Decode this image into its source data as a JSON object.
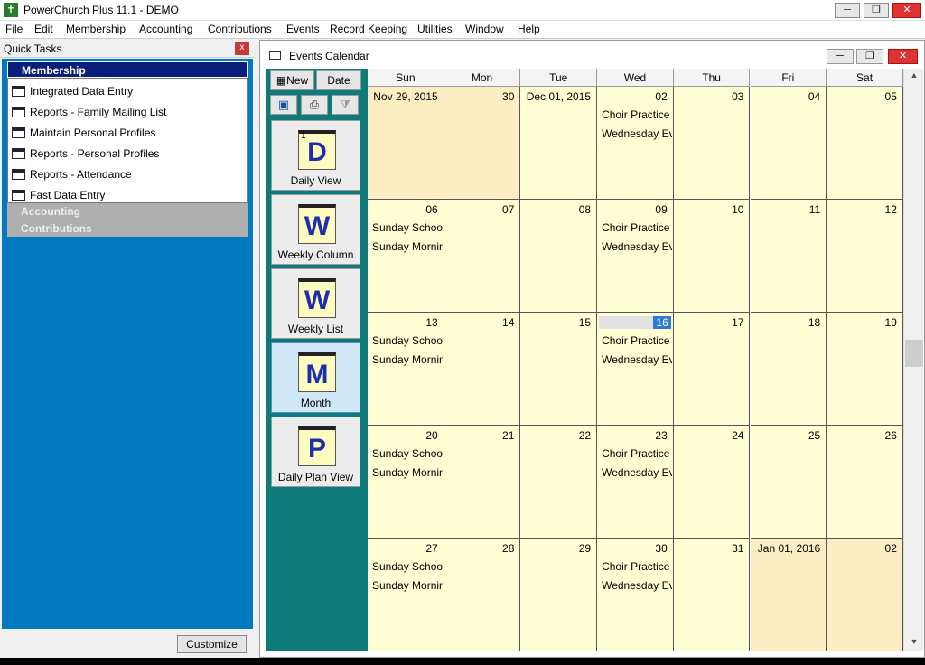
{
  "app": {
    "title": "PowerChurch Plus 11.1 - DEMO"
  },
  "menu": [
    "File",
    "Edit",
    "Membership",
    "Accounting",
    "Contributions",
    "Events",
    "Record Keeping",
    "Utilities",
    "Window",
    "Help"
  ],
  "quick_tasks": {
    "title": "Quick Tasks",
    "active_group": "Membership",
    "items": [
      "Integrated Data Entry",
      "Reports - Family Mailing List",
      "Maintain Personal Profiles",
      "Reports - Personal Profiles",
      "Reports - Attendance",
      "Fast Data Entry"
    ],
    "groups_collapsed": [
      "Accounting",
      "Contributions"
    ],
    "customize_label": "Customize"
  },
  "events_calendar": {
    "title": "Events Calendar",
    "toolbar": {
      "new_label": "New",
      "date_label": "Date"
    },
    "views": [
      {
        "label": "Daily View",
        "letter": "D",
        "corner": "1"
      },
      {
        "label": "Weekly Column",
        "letter": "W",
        "corner": ""
      },
      {
        "label": "Weekly List",
        "letter": "W",
        "corner": ""
      },
      {
        "label": "Month",
        "letter": "M",
        "corner": ""
      },
      {
        "label": "Daily Plan View",
        "letter": "P",
        "corner": ""
      }
    ],
    "selected_view": "Month",
    "weekdays": [
      "Sun",
      "Mon",
      "Tue",
      "Wed",
      "Thu",
      "Fri",
      "Sat"
    ],
    "weeks": [
      [
        {
          "d": "Nov 29, 2015",
          "other": true
        },
        {
          "d": "30",
          "other": true
        },
        {
          "d": "Dec 01, 2015"
        },
        {
          "d": "02",
          "events": [
            "Choir Practice",
            "Wednesday Evening"
          ]
        },
        {
          "d": "03"
        },
        {
          "d": "04"
        },
        {
          "d": "05"
        }
      ],
      [
        {
          "d": "06",
          "events": [
            "Sunday School",
            "Sunday Morning"
          ]
        },
        {
          "d": "07"
        },
        {
          "d": "08"
        },
        {
          "d": "09",
          "events": [
            "Choir Practice",
            "Wednesday Evening"
          ]
        },
        {
          "d": "10"
        },
        {
          "d": "11"
        },
        {
          "d": "12"
        }
      ],
      [
        {
          "d": "13",
          "events": [
            "Sunday School",
            "Sunday Morning"
          ]
        },
        {
          "d": "14"
        },
        {
          "d": "15"
        },
        {
          "d": "16",
          "selected": true,
          "events": [
            "Choir Practice",
            "Wednesday Evening"
          ]
        },
        {
          "d": "17"
        },
        {
          "d": "18"
        },
        {
          "d": "19"
        }
      ],
      [
        {
          "d": "20",
          "events": [
            "Sunday School",
            "Sunday Morning"
          ]
        },
        {
          "d": "21"
        },
        {
          "d": "22"
        },
        {
          "d": "23",
          "events": [
            "Choir Practice",
            "Wednesday Evening"
          ]
        },
        {
          "d": "24"
        },
        {
          "d": "25"
        },
        {
          "d": "26"
        }
      ],
      [
        {
          "d": "27",
          "events": [
            "Sunday School",
            "Sunday Morning"
          ]
        },
        {
          "d": "28"
        },
        {
          "d": "29"
        },
        {
          "d": "30",
          "events": [
            "Choir Practice",
            "Wednesday Evening"
          ]
        },
        {
          "d": "31"
        },
        {
          "d": "Jan 01, 2016",
          "other": true
        },
        {
          "d": "02",
          "other": true
        }
      ]
    ]
  }
}
